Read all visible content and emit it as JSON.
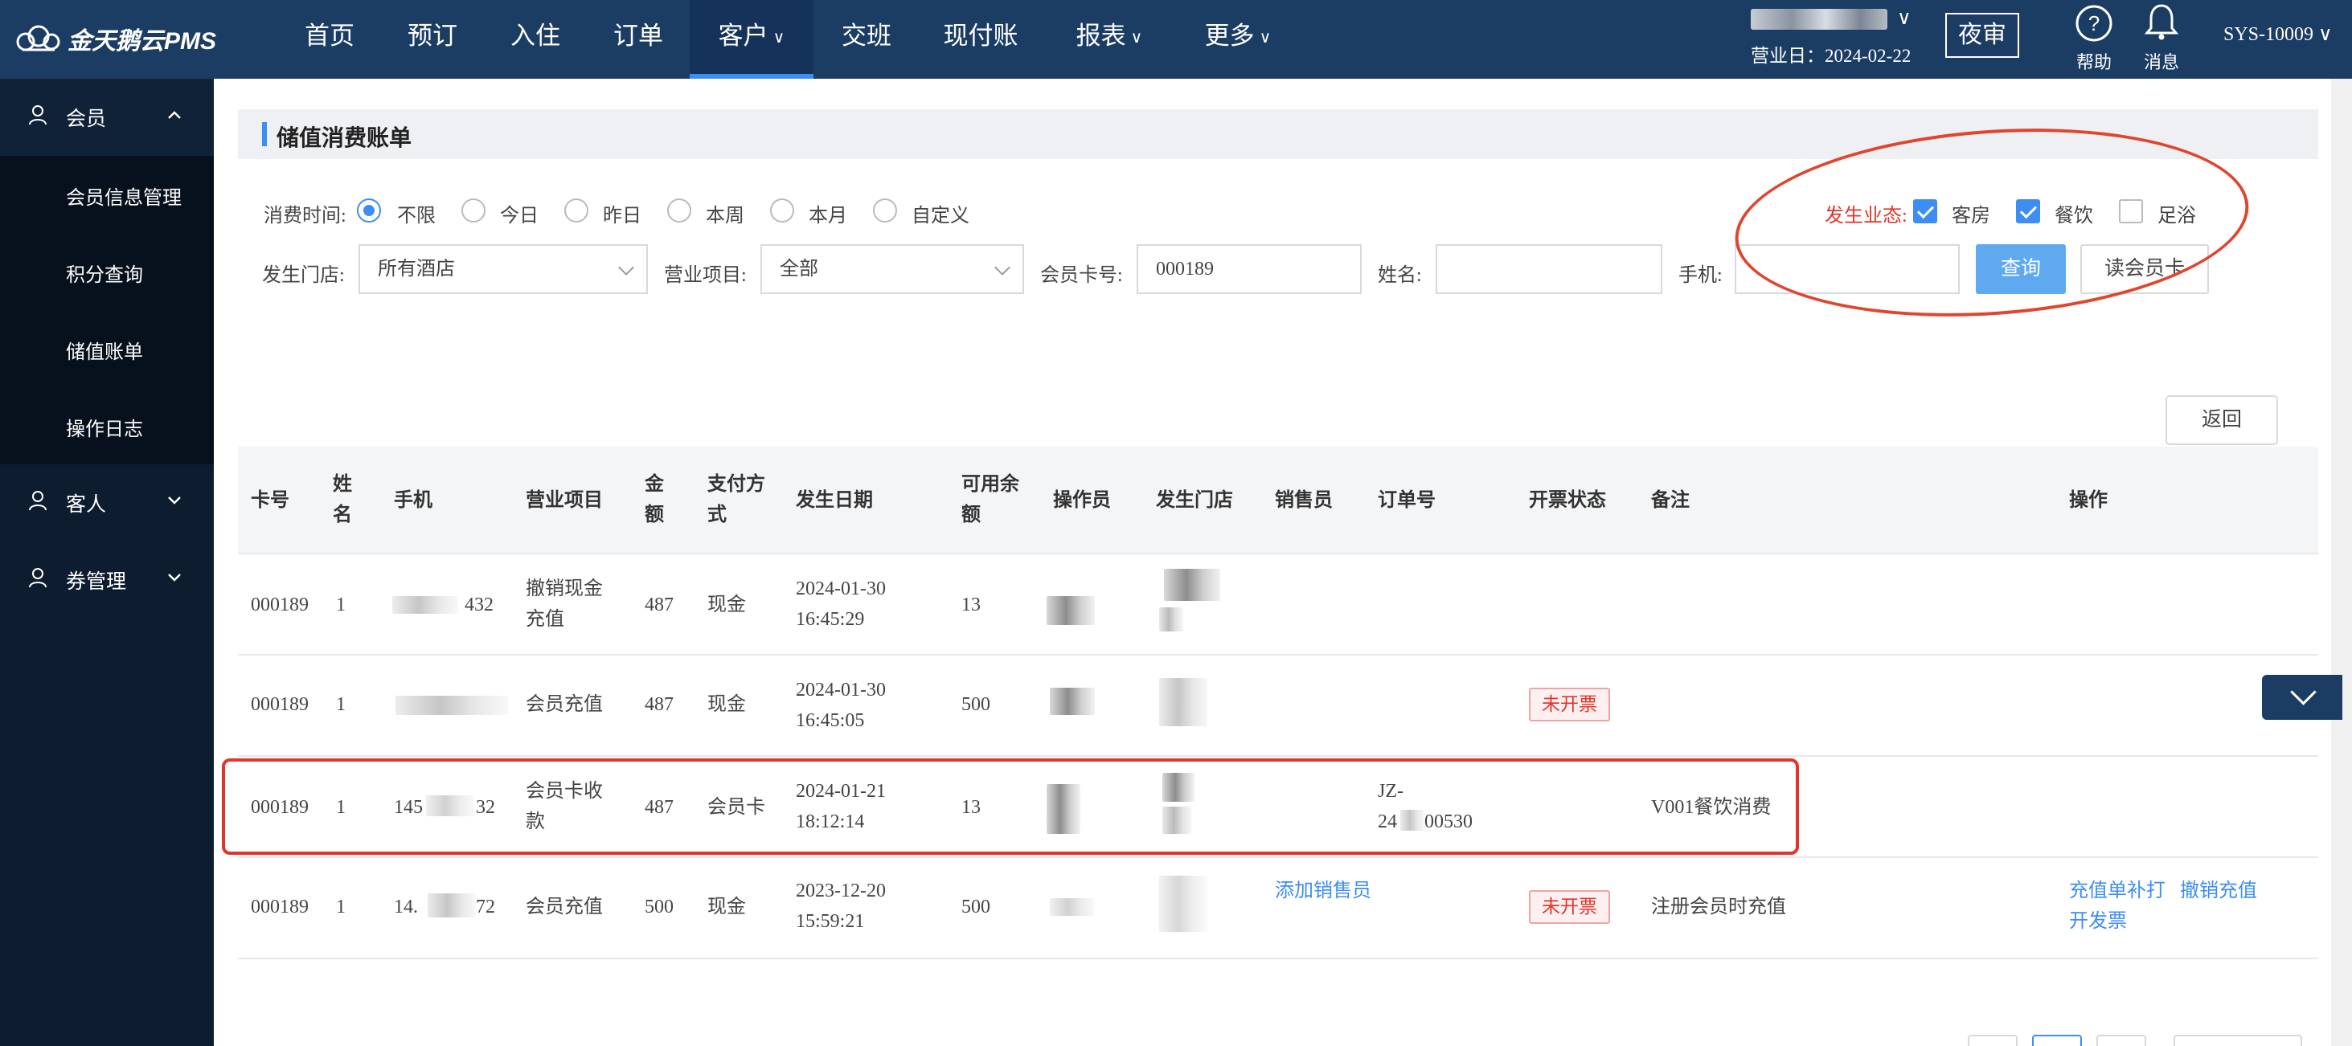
{
  "app": {
    "logo_text": "金天鹅云PMS"
  },
  "nav": {
    "items": [
      {
        "label": "首页",
        "dropdown": false
      },
      {
        "label": "预订",
        "dropdown": false
      },
      {
        "label": "入住",
        "dropdown": false
      },
      {
        "label": "订单",
        "dropdown": false
      },
      {
        "label": "客户",
        "dropdown": true,
        "active": true
      },
      {
        "label": "交班",
        "dropdown": false
      },
      {
        "label": "现付账",
        "dropdown": false
      },
      {
        "label": "报表",
        "dropdown": true
      },
      {
        "label": "更多",
        "dropdown": true
      }
    ]
  },
  "header": {
    "business_day": "营业日：2024-02-22",
    "night_audit": "夜审",
    "help": "帮助",
    "messages": "消息",
    "user_code": "SYS-10009",
    "chevron": "∨"
  },
  "sidebar": {
    "groups": [
      {
        "label": "会员",
        "expanded": true,
        "items": [
          "会员信息管理",
          "积分查询",
          "储值账单",
          "操作日志"
        ]
      },
      {
        "label": "客人",
        "expanded": false
      },
      {
        "label": "券管理",
        "expanded": false
      }
    ]
  },
  "page": {
    "title": "储值消费账单"
  },
  "filters": {
    "time_label": "消费时间:",
    "time_options": [
      {
        "label": "不限",
        "selected": true
      },
      {
        "label": "今日",
        "selected": false
      },
      {
        "label": "昨日",
        "selected": false
      },
      {
        "label": "本周",
        "selected": false
      },
      {
        "label": "本月",
        "selected": false
      },
      {
        "label": "自定义",
        "selected": false
      }
    ],
    "business_label": "发生业态:",
    "business_options": [
      {
        "label": "客房",
        "checked": true
      },
      {
        "label": "餐饮",
        "checked": true
      },
      {
        "label": "足浴",
        "checked": false
      }
    ],
    "store_label": "发生门店:",
    "store_value": "所有酒店",
    "project_label": "营业项目:",
    "project_value": "全部",
    "card_label": "会员卡号:",
    "card_value": "000189",
    "name_label": "姓名:",
    "phone_label": "手机:",
    "query_button": "查询",
    "read_card_button": "读会员卡",
    "back_button": "返回"
  },
  "table": {
    "headers": {
      "card": "卡号",
      "name": "姓名",
      "phone": "手机",
      "project": "营业项目",
      "amount": "金额",
      "pay": "支付方式",
      "date": "发生日期",
      "balance": "可用余额",
      "operator": "操作员",
      "store": "发生门店",
      "sales": "销售员",
      "order": "订单号",
      "invoice": "开票状态",
      "remark": "备注",
      "action": "操作"
    },
    "rows": [
      {
        "card": "000189",
        "name": "1",
        "phone_tail": "432",
        "project": "撤销现金充值",
        "amount": "487",
        "pay": "现金",
        "date": "2024-01-30",
        "time": "16:45:29",
        "balance": "13",
        "sales": "",
        "order": "",
        "invoice": "",
        "remark": "",
        "actions": []
      },
      {
        "card": "000189",
        "name": "1",
        "phone_tail": "",
        "project": "会员充值",
        "amount": "487",
        "pay": "现金",
        "date": "2024-01-30",
        "time": "16:45:05",
        "balance": "500",
        "sales": "",
        "order": "",
        "invoice": "未开票",
        "remark": "",
        "actions": []
      },
      {
        "card": "000189",
        "name": "1",
        "phone_head": "145",
        "phone_tail": "32",
        "project": "会员卡收款",
        "amount": "487",
        "pay": "会员卡",
        "date": "2024-01-21",
        "time": "18:12:14",
        "balance": "13",
        "sales": "",
        "order_head": "JZ-",
        "order_tail": "24",
        "order_end": "00530",
        "invoice": "",
        "remark": "V001餐饮消费",
        "actions": []
      },
      {
        "card": "000189",
        "name": "1",
        "phone_head": "14.",
        "phone_tail": "72",
        "project": "会员充值",
        "amount": "500",
        "pay": "现金",
        "date": "2023-12-20",
        "time": "15:59:21",
        "balance": "500",
        "sales": "添加销售员",
        "order": "",
        "invoice": "未开票",
        "remark": "注册会员时充值",
        "actions": [
          "充值单补打",
          "撤销充值",
          "开发票"
        ]
      }
    ]
  },
  "colors": {
    "topbar": "#1c3d63",
    "sidebar": "#0d1c2e",
    "accent": "#3c8ef2",
    "annotation": "#e0452e"
  }
}
